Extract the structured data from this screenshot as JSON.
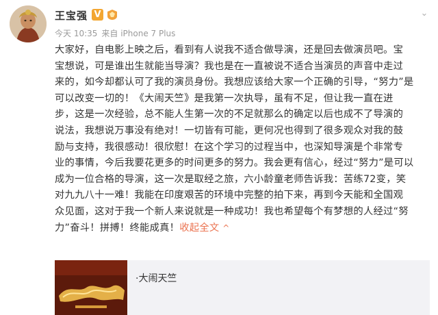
{
  "post": {
    "author": "王宝强",
    "time": "今天 10:35",
    "source": "来自 iPhone 7 Plus",
    "lines": [
      "大家好，自电影上映之后，看到有人说我不适合做导演，还是回去做演员吧。宝",
      "宝想说，可是谁出生就能当导演？我也是在一直被说不适合当演员的声音中走过",
      "来的，如今却都认可了我的演员身份。我想应该给大家一个正确的引导，“努力”是",
      "可以改变一切的！《大闹天竺》是我第一次执导，虽有不足，但让我一直在进",
      "步，这是一次经验，总不能人生第一次的不足就那么的确定以后也成不了导演的",
      "说法，我想说万事没有绝对！一切皆有可能，更何况也得到了很多观众对我的鼓",
      "励与支持，我很感动！很欣慰！在这个学习的过程当中，也深知导演是个非常专",
      "业的事情，今后我要花更多的时间更多的努力。我会更有信心，经过“努力”是可以",
      "成为一位合格的导演，这一次是取经之旅，六小龄童老师告诉我：苦练72变，笑",
      "对九九八十一难！我能在印度艰苦的环境中完整的拍下来，再到今天能和全国观",
      "众见面，这对于我一个新人来说就是一种成功！我也希望每个有梦想的人经过“努"
    ],
    "last_line": "力”奋斗！拼搏！终能成真！",
    "collapse_label": "收起全文",
    "collapse_arrow": "^"
  },
  "card": {
    "title": "·大闹天竺"
  },
  "colors": {
    "accent": "#eb7350",
    "meta": "#9a9a9a",
    "badge": "#f3a632",
    "card_bg": "#f2f2f5"
  },
  "icons": {
    "verified": "v-badge-icon",
    "vip": "vip-badge-icon",
    "more": "chevron-down-icon"
  }
}
